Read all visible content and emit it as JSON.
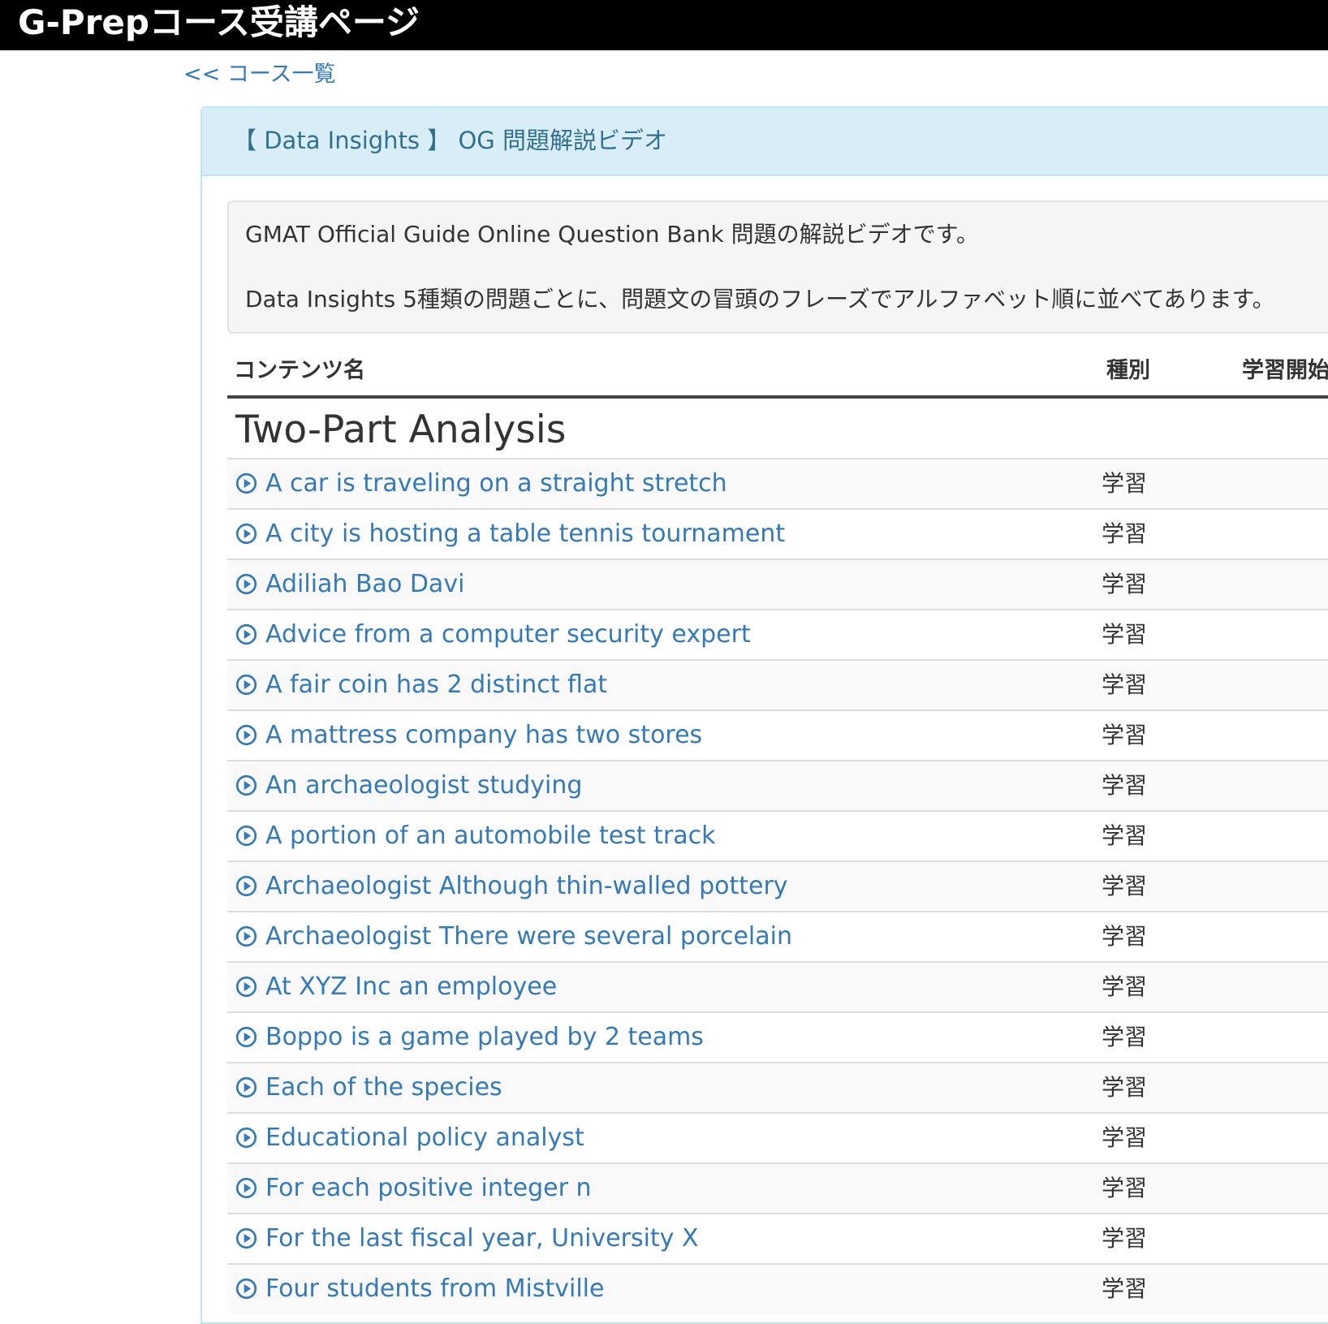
{
  "header": {
    "site_title": "G-Prepコース受講ページ"
  },
  "nav": {
    "back_link": "<< コース一覧"
  },
  "panel": {
    "title": "【 Data Insights 】 OG 問題解説ビデオ"
  },
  "description": {
    "line1": "GMAT Official Guide Online Question Bank 問題の解説ビデオです。",
    "line2": "Data Insights 5種類の問題ごとに、問題文の冒頭のフレーズでアルファベット順に並べてあります。"
  },
  "table": {
    "columns": {
      "name": "コンテンツ名",
      "type": "種別",
      "start": "学習開始"
    },
    "section_title": "Two-Part Analysis",
    "rows": [
      {
        "title": "A car is traveling on a straight stretch",
        "type": "学習"
      },
      {
        "title": "A city is hosting a table tennis tournament",
        "type": "学習"
      },
      {
        "title": "Adiliah Bao Davi",
        "type": "学習"
      },
      {
        "title": "Advice from a computer security expert",
        "type": "学習"
      },
      {
        "title": "A fair coin has 2 distinct flat",
        "type": "学習"
      },
      {
        "title": "A mattress company has two stores",
        "type": "学習"
      },
      {
        "title": "An archaeologist studying",
        "type": "学習"
      },
      {
        "title": "A portion of an automobile test track",
        "type": "学習"
      },
      {
        "title": "Archaeologist Although thin-walled pottery",
        "type": "学習"
      },
      {
        "title": "Archaeologist There were several porcelain",
        "type": "学習"
      },
      {
        "title": "At XYZ Inc an employee",
        "type": "学習"
      },
      {
        "title": "Boppo is a game played by 2 teams",
        "type": "学習"
      },
      {
        "title": "Each of the species",
        "type": "学習"
      },
      {
        "title": "Educational policy analyst",
        "type": "学習"
      },
      {
        "title": "For each positive integer n",
        "type": "学習"
      },
      {
        "title": "For the last fiscal year, University X",
        "type": "学習"
      },
      {
        "title": "Four students from Mistville",
        "type": "学習"
      }
    ]
  },
  "icons": {
    "row_icon": "play-circle-icon",
    "accent_color": "#337ab7"
  }
}
